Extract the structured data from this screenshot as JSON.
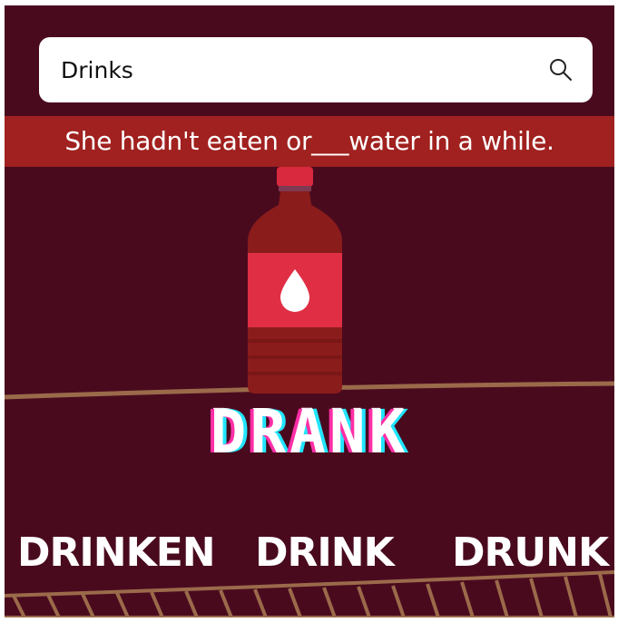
{
  "search": {
    "query": "Drinks",
    "icon": "search-icon"
  },
  "question": {
    "sentence": "She hadn't eaten or___water in a while."
  },
  "answer": {
    "word": "DRANK"
  },
  "choices": [
    {
      "label": "DRINKEN"
    },
    {
      "label": "DRINK"
    },
    {
      "label": "DRUNK"
    }
  ],
  "colors": {
    "background": "#4a0a1e",
    "banner": "#a0211f",
    "bottle": "#8b1c1c",
    "bottle_label": "#e02f45",
    "bottle_cap": "#d9293e",
    "shelf": "#9a6a4a",
    "answer_glow_left": "#ff2fa6",
    "answer_glow_right": "#22e5ff"
  },
  "bottle": {
    "label_icon": "water-drop-icon"
  }
}
